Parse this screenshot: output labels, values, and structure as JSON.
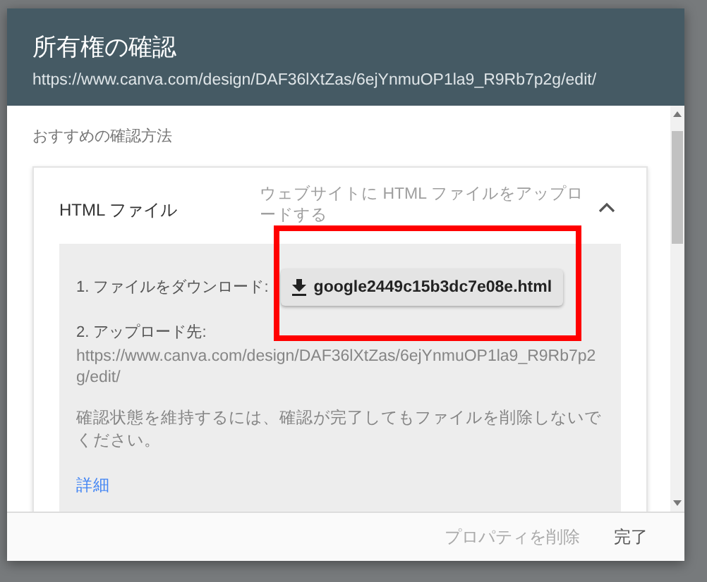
{
  "dialog": {
    "title": "所有権の確認",
    "subtitle": "https://www.canva.com/design/DAF36lXtZas/6ejYnmuOP1la9_R9Rb7p2g/edit/"
  },
  "section_label": "おすすめの確認方法",
  "method": {
    "name": "HTML ファイル",
    "description": "ウェブサイトに HTML ファイルをアップロードする",
    "expanded": true,
    "steps": [
      {
        "kind": "download",
        "label": "1. ファイルをダウンロード:",
        "button": "google2449c15b3dc7e08e.html"
      },
      {
        "kind": "upload",
        "label": "2. アップロード先:",
        "url": "https://www.canva.com/design/DAF36lXtZas/6ejYnmuOP1la9_R9Rb7p2g/edit/"
      }
    ],
    "note": "確認状態を維持するには、確認が完了してもファイルを削除しないでください。",
    "link": "詳細"
  },
  "footer": {
    "buttons": [
      {
        "label": "プロパティを削除",
        "kind": "secondary"
      },
      {
        "label": "完了",
        "kind": "primary"
      }
    ]
  },
  "annotation": {
    "kind": "highlight-box",
    "color": "#ff0000"
  }
}
